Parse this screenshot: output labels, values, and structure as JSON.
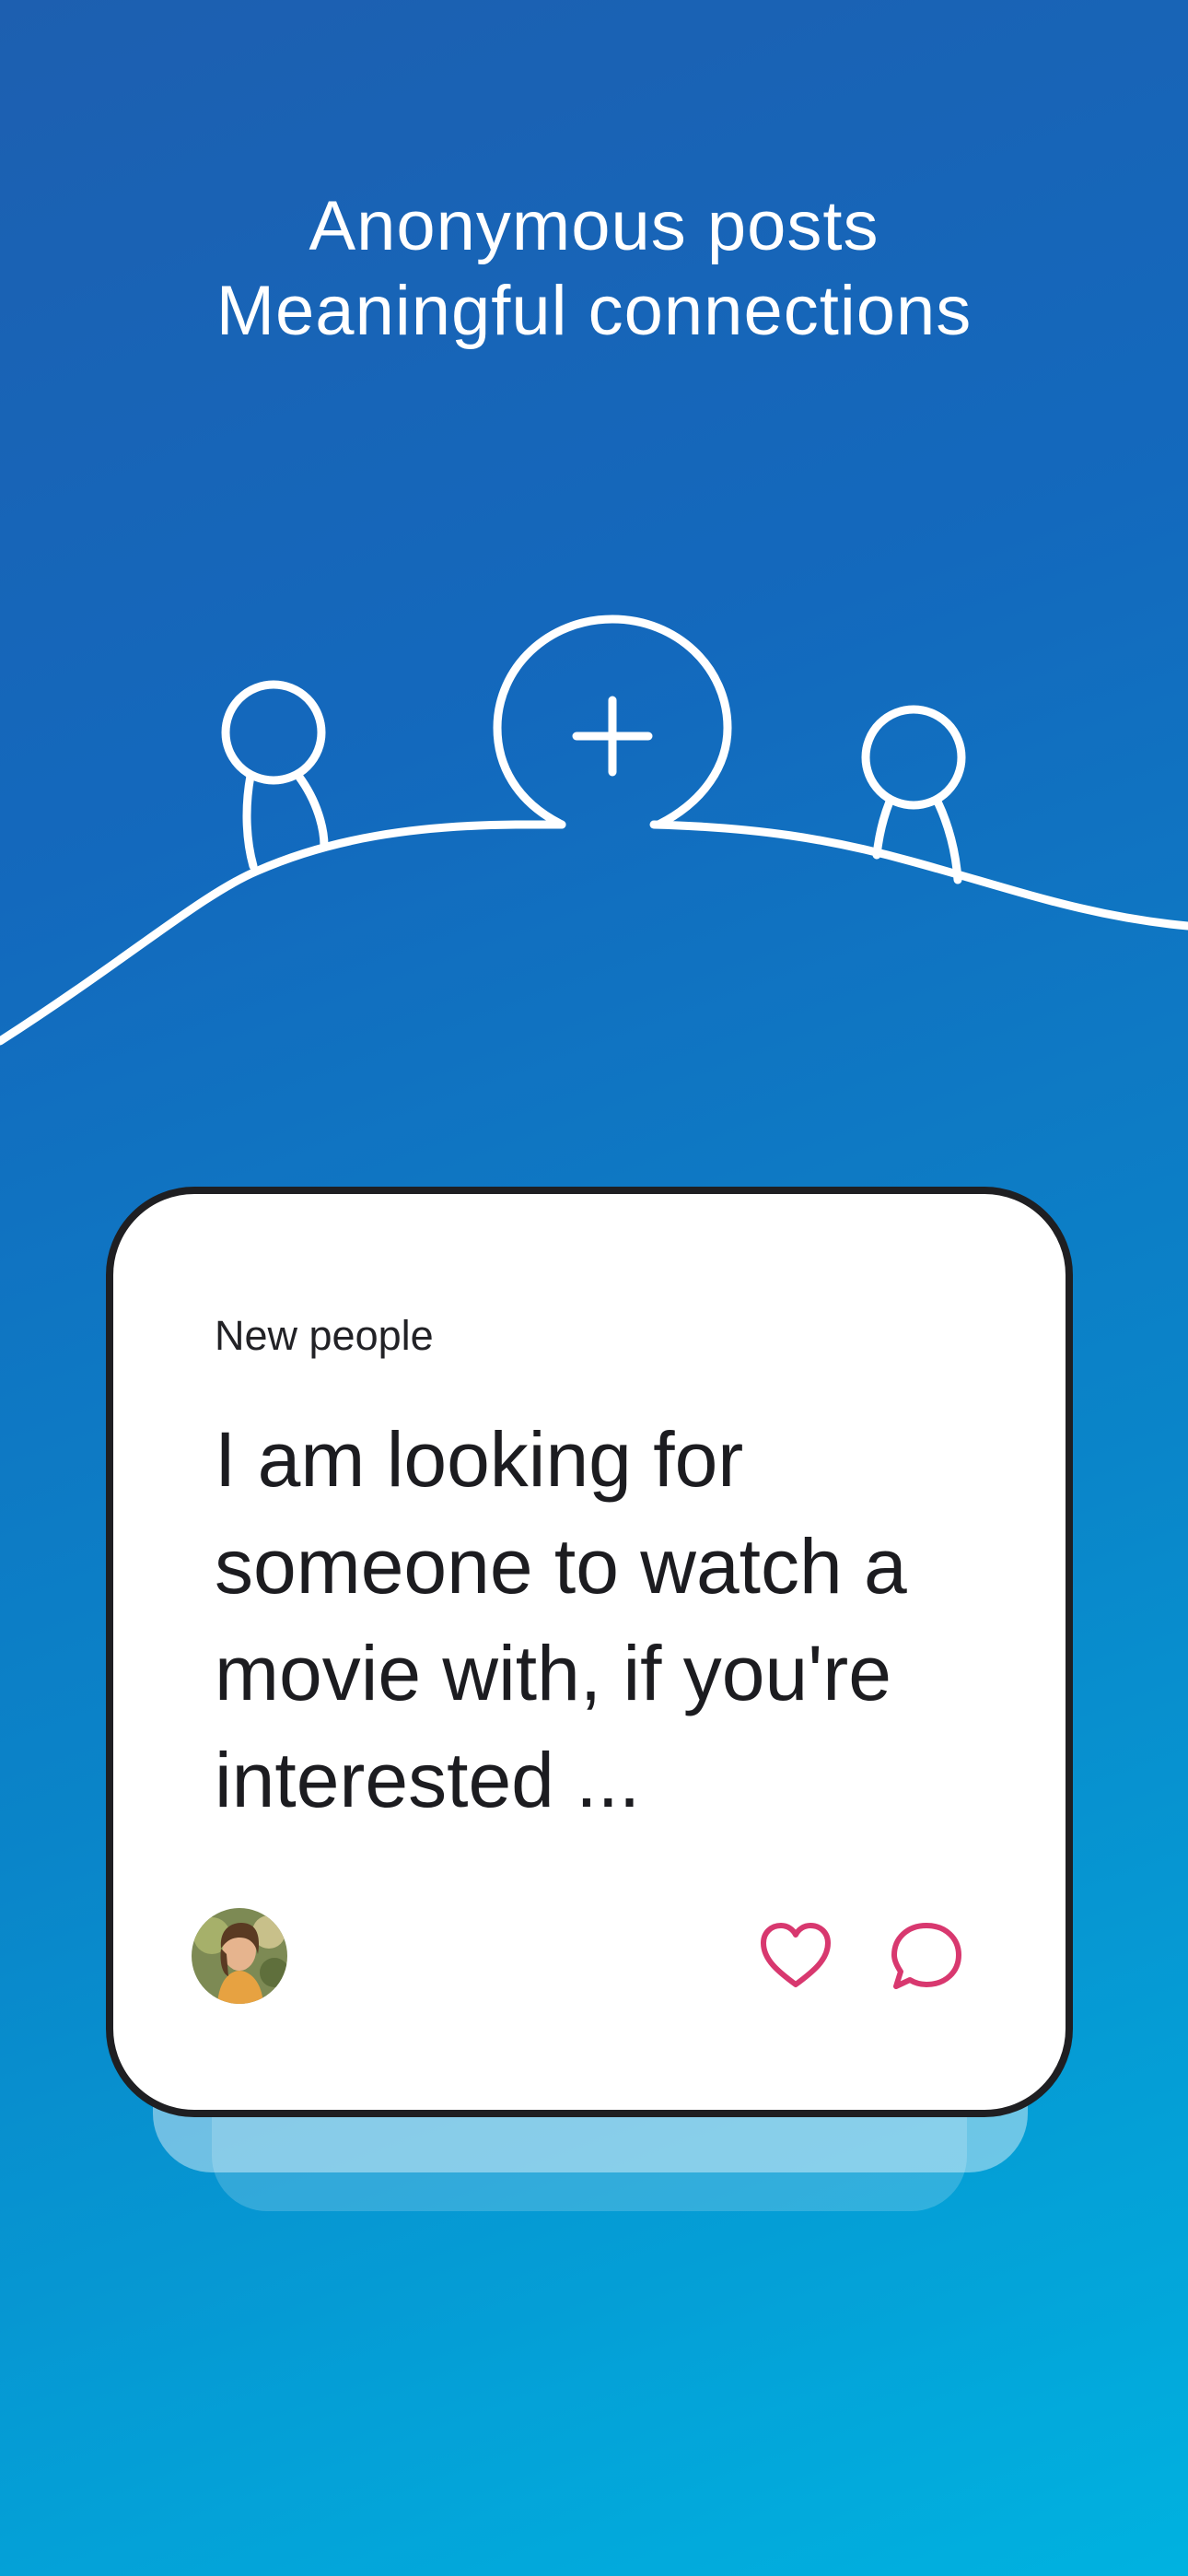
{
  "hero": {
    "line1": "Anonymous posts",
    "line2": "Meaningful connections"
  },
  "illustration": {
    "icons": [
      "person-icon",
      "add-post-icon",
      "person-icon"
    ]
  },
  "post": {
    "category": "New people",
    "text": "I am looking for someone to watch a movie with, if you're interested ...",
    "avatar_icon": "user-avatar",
    "actions": {
      "like_icon": "heart-icon",
      "comment_icon": "speech-bubble-icon"
    }
  },
  "colors": {
    "background_start": "#1d5fb0",
    "background_end": "#00b2e0",
    "card_border": "#1f1f22",
    "action_accent": "#d8386f",
    "text_dark": "#1c1c20"
  }
}
